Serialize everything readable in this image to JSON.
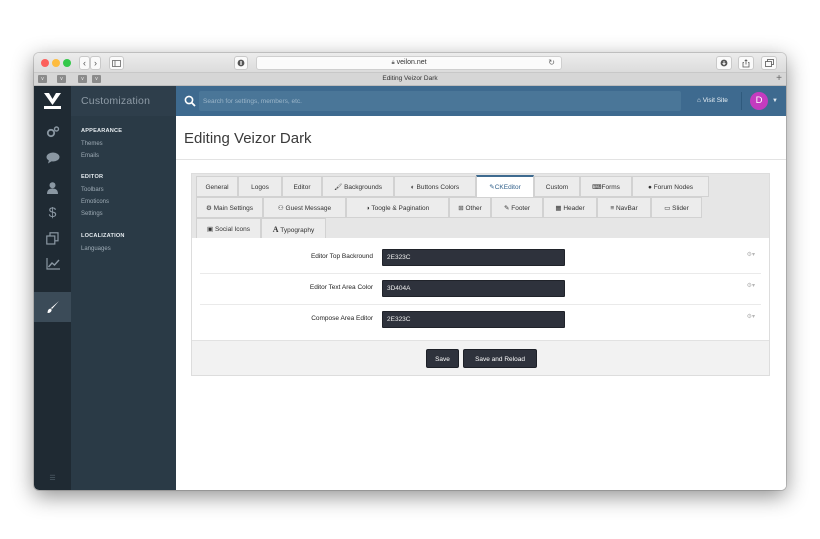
{
  "browser": {
    "url": "veilon.net",
    "tab_title": "Editing Veizor Dark",
    "back_glyph": "‹",
    "forward_glyph": "›",
    "new_tab_glyph": "+"
  },
  "app": {
    "section_title": "Customization",
    "search_placeholder": "Search for settings, members, etc.",
    "visit_site_label": "Visit Site",
    "avatar_initial": "D",
    "accent_color": "#3e6a8f",
    "avatar_color": "#c43bbf"
  },
  "rail_icons": [
    "gears-icon",
    "comments-icon",
    "user-icon",
    "dollar-icon",
    "clone-icon",
    "line-chart-icon",
    "paint-brush-icon"
  ],
  "subnav": {
    "appearance": {
      "title": "APPEARANCE",
      "items": [
        "Themes",
        "Emails"
      ]
    },
    "editor": {
      "title": "EDITOR",
      "items": [
        "Toolbars",
        "Emoticons",
        "Settings"
      ]
    },
    "localization": {
      "title": "LOCALIZATION",
      "items": [
        "Languages"
      ]
    }
  },
  "page": {
    "title": "Editing Veizor Dark"
  },
  "tabs": [
    {
      "label": "General"
    },
    {
      "label": "Logos"
    },
    {
      "label": "Editor"
    },
    {
      "label": "Backgrounds",
      "icon": "brush-icon"
    },
    {
      "label": "Buttons Colors",
      "icon": "palette-icon"
    },
    {
      "label": "CKEditor",
      "icon": "edit-icon",
      "active": true
    },
    {
      "label": "Custom"
    },
    {
      "label": "Forms",
      "icon": "keyboard-icon"
    },
    {
      "label": "Forum Nodes",
      "icon": "comments-icon"
    },
    {
      "label": "Main Settings",
      "icon": "cog-icon"
    },
    {
      "label": "Guest Message",
      "icon": "users-icon"
    },
    {
      "label": "Toogle & Pagination",
      "icon": "toggle-icon"
    },
    {
      "label": "Other",
      "icon": "plus-square-icon"
    },
    {
      "label": "Footer",
      "icon": "pencil-icon"
    },
    {
      "label": "Header",
      "icon": "grid-icon"
    },
    {
      "label": "NavBar",
      "icon": "bars-icon"
    },
    {
      "label": "Slider",
      "icon": "monitor-icon"
    },
    {
      "label": "Social Icons",
      "icon": "share-icon"
    },
    {
      "label": "Typography",
      "icon": "font-icon"
    }
  ],
  "fields": [
    {
      "label": "Editor Top Backround",
      "value": "2E323C"
    },
    {
      "label": "Editor Text Area Color",
      "value": "3D404A"
    },
    {
      "label": "Compose Area Editor",
      "value": "2E323C"
    }
  ],
  "buttons": {
    "save": "Save",
    "save_reload": "Save and Reload"
  }
}
